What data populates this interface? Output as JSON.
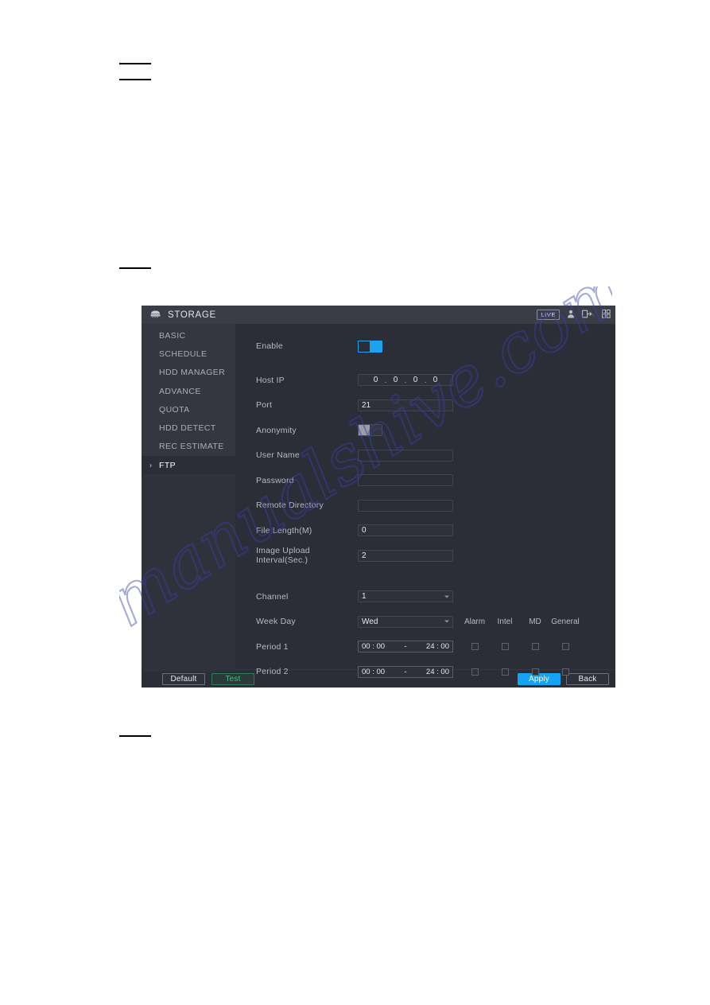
{
  "page": {
    "background": "#ffffff",
    "redaction_marks": 4
  },
  "watermark": {
    "text": "manualshive.com"
  },
  "device_ui": {
    "titlebar": {
      "icon": "hdd-icon",
      "title": "STORAGE",
      "live_badge": "LIVE",
      "icons": [
        "user-icon",
        "logout-icon",
        "chevron-down-icon",
        "grid-apps-icon"
      ]
    },
    "sidebar": {
      "items": [
        {
          "label": "BASIC",
          "active": false
        },
        {
          "label": "SCHEDULE",
          "active": false
        },
        {
          "label": "HDD MANAGER",
          "active": false
        },
        {
          "label": "ADVANCE",
          "active": false
        },
        {
          "label": "QUOTA",
          "active": false
        },
        {
          "label": "HDD DETECT",
          "active": false
        },
        {
          "label": "REC ESTIMATE",
          "active": false
        },
        {
          "label": "FTP",
          "active": true
        }
      ]
    },
    "form": {
      "enable": {
        "label": "Enable",
        "state": "on"
      },
      "host_ip": {
        "label": "Host IP",
        "octets": [
          "0",
          "0",
          "0",
          "0"
        ],
        "separator": "."
      },
      "port": {
        "label": "Port",
        "value": "21"
      },
      "anonymity": {
        "label": "Anonymity",
        "state": "off"
      },
      "user_name": {
        "label": "User Name",
        "value": ""
      },
      "password": {
        "label": "Password",
        "value": ""
      },
      "remote_directory": {
        "label": "Remote Directory",
        "value": ""
      },
      "file_length": {
        "label": "File Length(M)",
        "value": "0"
      },
      "image_upload_interval": {
        "label": "Image Upload Interval(Sec.)",
        "value": "2"
      },
      "channel": {
        "label": "Channel",
        "value": "1"
      },
      "week_day": {
        "label": "Week Day",
        "value": "Wed"
      },
      "event_columns": [
        "Alarm",
        "Intel",
        "MD",
        "General"
      ],
      "periods": [
        {
          "label": "Period 1",
          "start": "00 : 00",
          "dash": "-",
          "end": "24 : 00",
          "alarm": false,
          "intel": false,
          "md": false,
          "general": false
        },
        {
          "label": "Period 2",
          "start": "00 : 00",
          "dash": "-",
          "end": "24 : 00",
          "alarm": false,
          "intel": false,
          "md": false,
          "general": false
        }
      ]
    },
    "footer": {
      "default_label": "Default",
      "test_label": "Test",
      "apply_label": "Apply",
      "back_label": "Back"
    },
    "colors": {
      "accent_blue": "#13a4f4",
      "test_green": "#32c98a",
      "panel_bg": "#2b2e36",
      "sidebar_bg": "#343740",
      "titlebar_bg": "#3a3d45"
    }
  }
}
